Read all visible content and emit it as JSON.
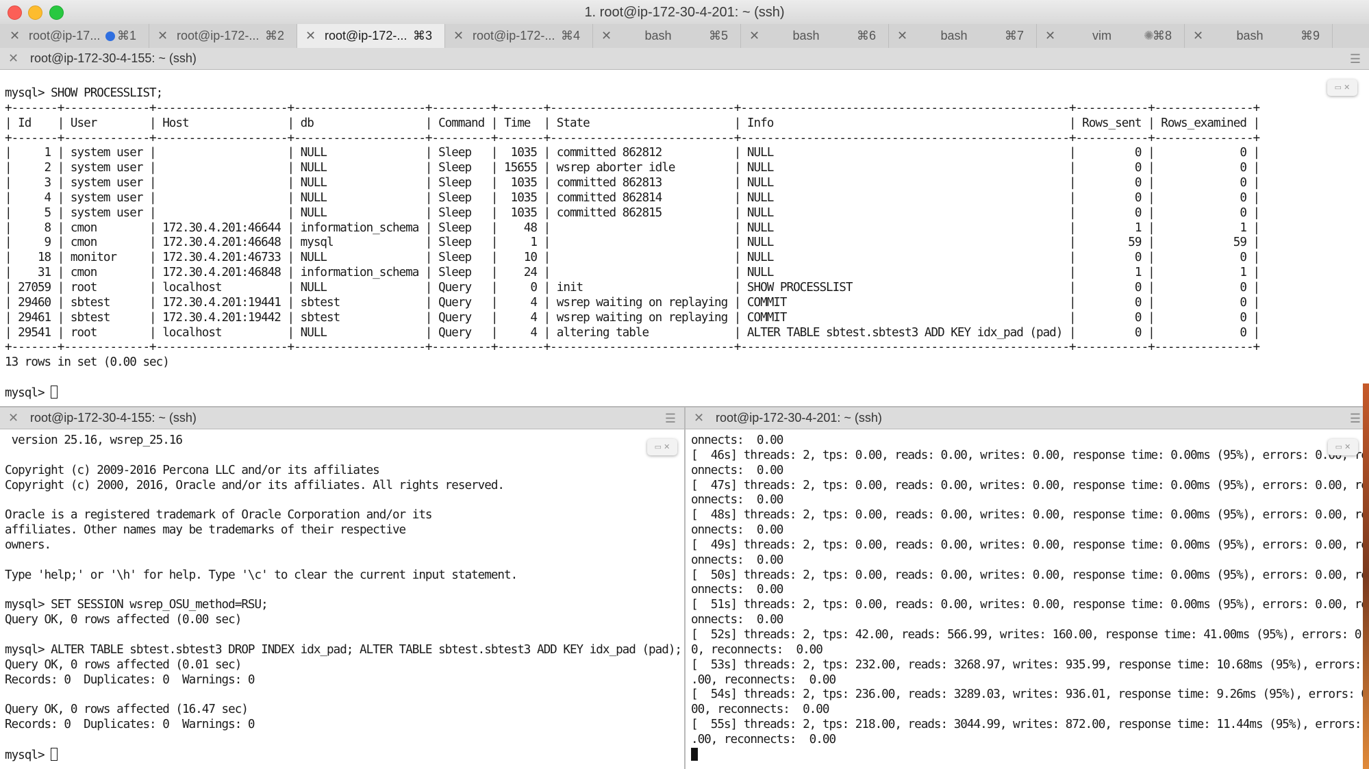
{
  "window": {
    "title": "1. root@ip-172-30-4-201: ~ (ssh)"
  },
  "tabs": [
    {
      "label": "root@ip-17...",
      "shortcut": "⌘1",
      "badge": "dot"
    },
    {
      "label": "root@ip-172-...",
      "shortcut": "⌘2"
    },
    {
      "label": "root@ip-172-...",
      "shortcut": "⌘3",
      "active": true
    },
    {
      "label": "root@ip-172-...",
      "shortcut": "⌘4"
    },
    {
      "label": "bash",
      "shortcut": "⌘5"
    },
    {
      "label": "bash",
      "shortcut": "⌘6"
    },
    {
      "label": "bash",
      "shortcut": "⌘7"
    },
    {
      "label": "vim",
      "shortcut": "⌘8",
      "badge": "spinner"
    },
    {
      "label": "bash",
      "shortcut": "⌘9"
    }
  ],
  "panes": {
    "top": {
      "title": "root@ip-172-30-4-155: ~ (ssh)",
      "prompt_cmd": "mysql> SHOW PROCESSLIST;",
      "table": {
        "columns": [
          "Id",
          "User",
          "Host",
          "db",
          "Command",
          "Time",
          "State",
          "Info",
          "Rows_sent",
          "Rows_examined"
        ],
        "rows": [
          [
            "1",
            "system user",
            "",
            "NULL",
            "Sleep",
            "1035",
            "committed 862812",
            "NULL",
            "0",
            "0"
          ],
          [
            "2",
            "system user",
            "",
            "NULL",
            "Sleep",
            "15655",
            "wsrep aborter idle",
            "NULL",
            "0",
            "0"
          ],
          [
            "3",
            "system user",
            "",
            "NULL",
            "Sleep",
            "1035",
            "committed 862813",
            "NULL",
            "0",
            "0"
          ],
          [
            "4",
            "system user",
            "",
            "NULL",
            "Sleep",
            "1035",
            "committed 862814",
            "NULL",
            "0",
            "0"
          ],
          [
            "5",
            "system user",
            "",
            "NULL",
            "Sleep",
            "1035",
            "committed 862815",
            "NULL",
            "0",
            "0"
          ],
          [
            "8",
            "cmon",
            "172.30.4.201:46644",
            "information_schema",
            "Sleep",
            "48",
            "",
            "NULL",
            "1",
            "1"
          ],
          [
            "9",
            "cmon",
            "172.30.4.201:46648",
            "mysql",
            "Sleep",
            "1",
            "",
            "NULL",
            "59",
            "59"
          ],
          [
            "18",
            "monitor",
            "172.30.4.201:46733",
            "NULL",
            "Sleep",
            "10",
            "",
            "NULL",
            "0",
            "0"
          ],
          [
            "31",
            "cmon",
            "172.30.4.201:46848",
            "information_schema",
            "Sleep",
            "24",
            "",
            "NULL",
            "1",
            "1"
          ],
          [
            "27059",
            "root",
            "localhost",
            "NULL",
            "Query",
            "0",
            "init",
            "SHOW PROCESSLIST",
            "0",
            "0"
          ],
          [
            "29460",
            "sbtest",
            "172.30.4.201:19441",
            "sbtest",
            "Query",
            "4",
            "wsrep waiting on replaying",
            "COMMIT",
            "0",
            "0"
          ],
          [
            "29461",
            "sbtest",
            "172.30.4.201:19442",
            "sbtest",
            "Query",
            "4",
            "wsrep waiting on replaying",
            "COMMIT",
            "0",
            "0"
          ],
          [
            "29541",
            "root",
            "localhost",
            "NULL",
            "Query",
            "4",
            "altering table",
            "ALTER TABLE sbtest.sbtest3 ADD KEY idx_pad (pad)",
            "0",
            "0"
          ]
        ]
      },
      "summary": "13 rows in set (0.00 sec)",
      "prompt": "mysql> "
    },
    "bottom_left": {
      "title": "root@ip-172-30-4-155: ~ (ssh)",
      "lines": [
        " version 25.16, wsrep_25.16",
        "",
        "Copyright (c) 2009-2016 Percona LLC and/or its affiliates",
        "Copyright (c) 2000, 2016, Oracle and/or its affiliates. All rights reserved.",
        "",
        "Oracle is a registered trademark of Oracle Corporation and/or its",
        "affiliates. Other names may be trademarks of their respective",
        "owners.",
        "",
        "Type 'help;' or '\\h' for help. Type '\\c' to clear the current input statement.",
        "",
        "mysql> SET SESSION wsrep_OSU_method=RSU;",
        "Query OK, 0 rows affected (0.00 sec)",
        "",
        "mysql> ALTER TABLE sbtest.sbtest3 DROP INDEX idx_pad; ALTER TABLE sbtest.sbtest3 ADD KEY idx_pad (pad);",
        "Query OK, 0 rows affected (0.01 sec)",
        "Records: 0  Duplicates: 0  Warnings: 0",
        "",
        "Query OK, 0 rows affected (16.47 sec)",
        "Records: 0  Duplicates: 0  Warnings: 0",
        ""
      ],
      "prompt": "mysql> "
    },
    "bottom_right": {
      "title": "root@ip-172-30-4-201: ~ (ssh)",
      "lines": [
        "onnects:  0.00",
        "[  46s] threads: 2, tps: 0.00, reads: 0.00, writes: 0.00, response time: 0.00ms (95%), errors: 0.00, rec",
        "onnects:  0.00",
        "[  47s] threads: 2, tps: 0.00, reads: 0.00, writes: 0.00, response time: 0.00ms (95%), errors: 0.00, rec",
        "onnects:  0.00",
        "[  48s] threads: 2, tps: 0.00, reads: 0.00, writes: 0.00, response time: 0.00ms (95%), errors: 0.00, rec",
        "onnects:  0.00",
        "[  49s] threads: 2, tps: 0.00, reads: 0.00, writes: 0.00, response time: 0.00ms (95%), errors: 0.00, rec",
        "onnects:  0.00",
        "[  50s] threads: 2, tps: 0.00, reads: 0.00, writes: 0.00, response time: 0.00ms (95%), errors: 0.00, rec",
        "onnects:  0.00",
        "[  51s] threads: 2, tps: 0.00, reads: 0.00, writes: 0.00, response time: 0.00ms (95%), errors: 0.00, rec",
        "onnects:  0.00",
        "[  52s] threads: 2, tps: 42.00, reads: 566.99, writes: 160.00, response time: 41.00ms (95%), errors: 0.0",
        "0, reconnects:  0.00",
        "[  53s] threads: 2, tps: 232.00, reads: 3268.97, writes: 935.99, response time: 10.68ms (95%), errors: 0",
        ".00, reconnects:  0.00",
        "[  54s] threads: 2, tps: 236.00, reads: 3289.03, writes: 936.01, response time: 9.26ms (95%), errors: 0.",
        "00, reconnects:  0.00",
        "[  55s] threads: 2, tps: 218.00, reads: 3044.99, writes: 872.00, response time: 11.44ms (95%), errors: 0",
        ".00, reconnects:  0.00"
      ]
    }
  },
  "icons": {
    "close": "close-icon",
    "menu": "pane-menu-icon"
  }
}
